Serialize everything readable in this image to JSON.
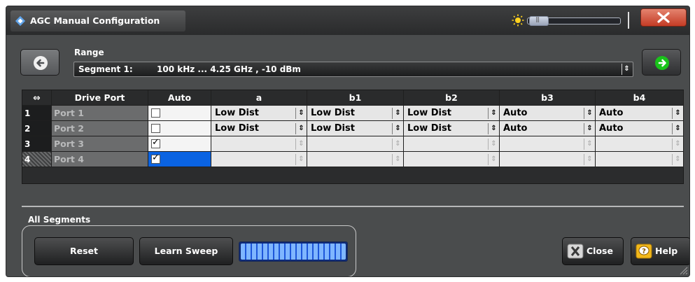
{
  "window": {
    "title": "AGC Manual Configuration"
  },
  "range": {
    "label": "Range",
    "prefix": "Segment 1:",
    "value": "100 kHz ... 4.25 GHz ,   -10 dBm",
    "spin": "⇕"
  },
  "table": {
    "corner": "⇔",
    "headers": [
      "Drive Port",
      "Auto",
      "a",
      "b1",
      "b2",
      "b3",
      "b4"
    ],
    "rows": [
      {
        "index": "1",
        "port": "Port 1",
        "auto": false,
        "a": "Low Dist",
        "b1": "Low Dist",
        "b2": "Low Dist",
        "b3": "Auto",
        "b4": "Auto"
      },
      {
        "index": "2",
        "port": "Port 2",
        "auto": false,
        "a": "Low Dist",
        "b1": "Low Dist",
        "b2": "Low Dist",
        "b3": "Auto",
        "b4": "Auto"
      },
      {
        "index": "3",
        "port": "Port 3",
        "auto": true,
        "a": "",
        "b1": "",
        "b2": "",
        "b3": "",
        "b4": ""
      },
      {
        "index": "4",
        "port": "Port 4",
        "auto": true,
        "a": "",
        "b1": "",
        "b2": "",
        "b3": "",
        "b4": ""
      }
    ]
  },
  "all_segments": {
    "label": "All Segments",
    "reset_label": "Reset",
    "learn_label": "Learn Sweep",
    "progress": 1.0
  },
  "buttons": {
    "close_label": "Close",
    "help_label": "Help"
  },
  "colors": {
    "window_bg": "#4a4c4d",
    "selection": "#0a63e2",
    "close_red": "#c43c25",
    "next_green": "#19c31a",
    "progress_fill": "#7fb6ff"
  },
  "icons": {
    "app": "rs-logo-icon",
    "brightness": "sun-icon",
    "prev": "arrow-left-icon",
    "next": "arrow-right-icon",
    "close": "close-x-icon",
    "help": "help-bubble-icon"
  }
}
